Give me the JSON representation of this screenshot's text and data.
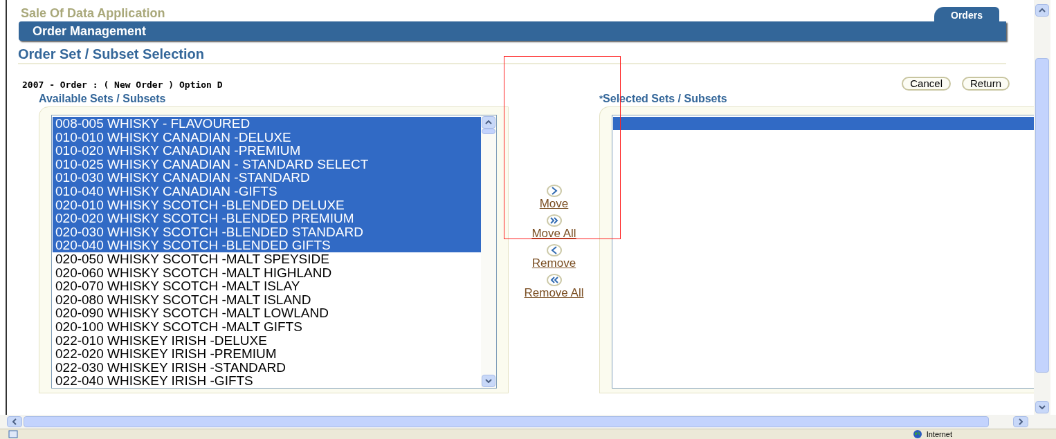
{
  "app_title": "Sale Of Data Application",
  "tabs": [
    {
      "label": "Orders",
      "selected": true
    }
  ],
  "section_bar": {
    "title": "Order Management"
  },
  "page_title": "Order Set / Subset Selection",
  "order_info": "2007 - Order : ( New Order ) Option D",
  "buttons": [
    "Cancel",
    "Return"
  ],
  "available": {
    "heading": "Available Sets / Subsets",
    "items": [
      {
        "label": "008-005 WHISKY - FLAVOURED",
        "selected": true
      },
      {
        "label": "010-010 WHISKY CANADIAN -DELUXE",
        "selected": true
      },
      {
        "label": "010-020 WHISKY CANADIAN -PREMIUM",
        "selected": true
      },
      {
        "label": "010-025 WHISKY CANADIAN - STANDARD SELECT",
        "selected": true
      },
      {
        "label": "010-030 WHISKY CANADIAN -STANDARD",
        "selected": true
      },
      {
        "label": "010-040 WHISKY CANADIAN -GIFTS",
        "selected": true
      },
      {
        "label": "020-010 WHISKY SCOTCH -BLENDED DELUXE",
        "selected": true
      },
      {
        "label": "020-020 WHISKY SCOTCH -BLENDED PREMIUM",
        "selected": true
      },
      {
        "label": "020-030 WHISKY SCOTCH -BLENDED STANDARD",
        "selected": true
      },
      {
        "label": "020-040 WHISKY SCOTCH -BLENDED GIFTS",
        "selected": true
      },
      {
        "label": "020-050 WHISKY SCOTCH -MALT SPEYSIDE",
        "selected": false
      },
      {
        "label": "020-060 WHISKY SCOTCH -MALT HIGHLAND",
        "selected": false
      },
      {
        "label": "020-070 WHISKY SCOTCH -MALT ISLAY",
        "selected": false
      },
      {
        "label": "020-080 WHISKY SCOTCH -MALT ISLAND",
        "selected": false
      },
      {
        "label": "020-090 WHISKY SCOTCH -MALT LOWLAND",
        "selected": false
      },
      {
        "label": "020-100 WHISKY SCOTCH -MALT GIFTS",
        "selected": false
      },
      {
        "label": "022-010 WHISKEY IRISH -DELUXE",
        "selected": false
      },
      {
        "label": "022-020 WHISKEY IRISH -PREMIUM",
        "selected": false
      },
      {
        "label": "022-030 WHISKEY IRISH -STANDARD",
        "selected": false
      },
      {
        "label": "022-040 WHISKEY IRISH -GIFTS",
        "selected": false
      }
    ]
  },
  "shuttle_actions": [
    {
      "kind": "move",
      "label": "Move"
    },
    {
      "kind": "move_all",
      "label": "Move All"
    },
    {
      "kind": "remove",
      "label": "Remove"
    },
    {
      "kind": "remove_all",
      "label": "Remove All"
    }
  ],
  "selected": {
    "required_mark": "*",
    "heading": "Selected Sets / Subsets"
  },
  "status_bar": {
    "zone": "Internet"
  }
}
